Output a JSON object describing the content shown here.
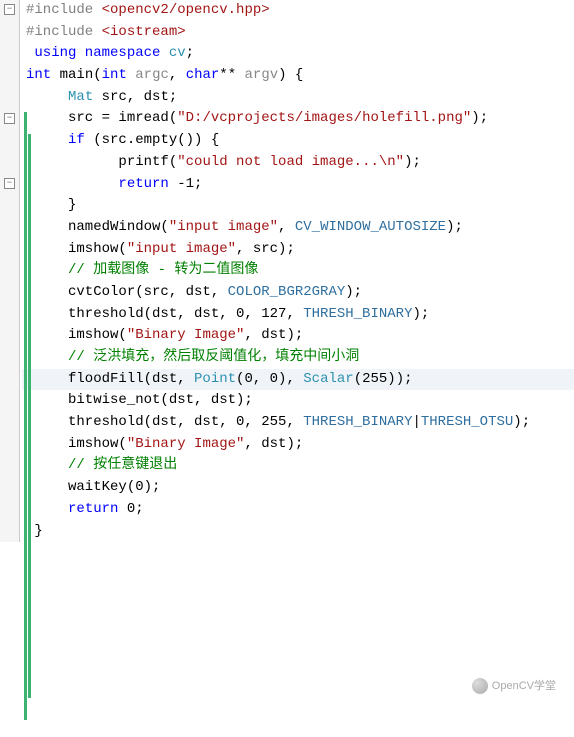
{
  "lines": {
    "l1a": "#include",
    "l1b": " <opencv2/opencv.hpp>",
    "l2a": "#include",
    "l2b": " <iostream>",
    "l3": "",
    "l4a": " using namespace ",
    "l4b": "cv",
    "l4c": ";",
    "l5a": "int",
    "l5b": " main(",
    "l5c": "int",
    "l5d": " ",
    "l5e": "argc",
    "l5f": ", ",
    "l5g": "char",
    "l5h": "** ",
    "l5i": "argv",
    "l5j": ") {",
    "l6a": "     ",
    "l6b": "Mat",
    "l6c": " src, dst;",
    "l7a": "     src = imread(",
    "l7b": "\"D:/vcprojects/images/holefill.png\"",
    "l7c": ");",
    "l8a": "     ",
    "l8b": "if",
    "l8c": " (src.empty()) {",
    "l9a": "           printf(",
    "l9b": "\"could not load image...\\n\"",
    "l9c": ");",
    "l10a": "           ",
    "l10b": "return",
    "l10c": " -1;",
    "l11": "     }",
    "l12a": "     namedWindow(",
    "l12b": "\"input image\"",
    "l12c": ", ",
    "l12d": "CV_WINDOW_AUTOSIZE",
    "l12e": ");",
    "l13a": "     imshow(",
    "l13b": "\"input image\"",
    "l13c": ", src);",
    "l14": "",
    "l15": "     // 加载图像 - 转为二值图像",
    "l16a": "     cvtColor(src, dst, ",
    "l16b": "COLOR_BGR2GRAY",
    "l16c": ");",
    "l17a": "     threshold(dst, dst, 0, 127, ",
    "l17b": "THRESH_BINARY",
    "l17c": ");",
    "l18a": "     imshow(",
    "l18b": "\"Binary Image\"",
    "l18c": ", dst);",
    "l19": "",
    "l20": "     // 泛洪填充，然后取反阈值化，填充中间小洞",
    "l21a": "     floodFill(dst, ",
    "l21b": "Point",
    "l21c": "(0, 0), ",
    "l21d": "Scalar",
    "l21e": "(255));",
    "l22": "     bitwise_not(dst, dst);",
    "l23a": "     threshold(dst, dst, 0, 255, ",
    "l23b": "THRESH_BINARY",
    "l23c": "|",
    "l23d": "THRESH_OTSU",
    "l23e": ");",
    "l24a": "     imshow(",
    "l24b": "\"Binary Image\"",
    "l24c": ", dst);",
    "l25": "",
    "l26": "     // 按任意键退出",
    "l27": "     waitKey(0);",
    "l28a": "     ",
    "l28b": "return",
    "l28c": " 0;",
    "l29": " }"
  },
  "watermark": "OpenCV学堂",
  "fold_glyph": "−"
}
